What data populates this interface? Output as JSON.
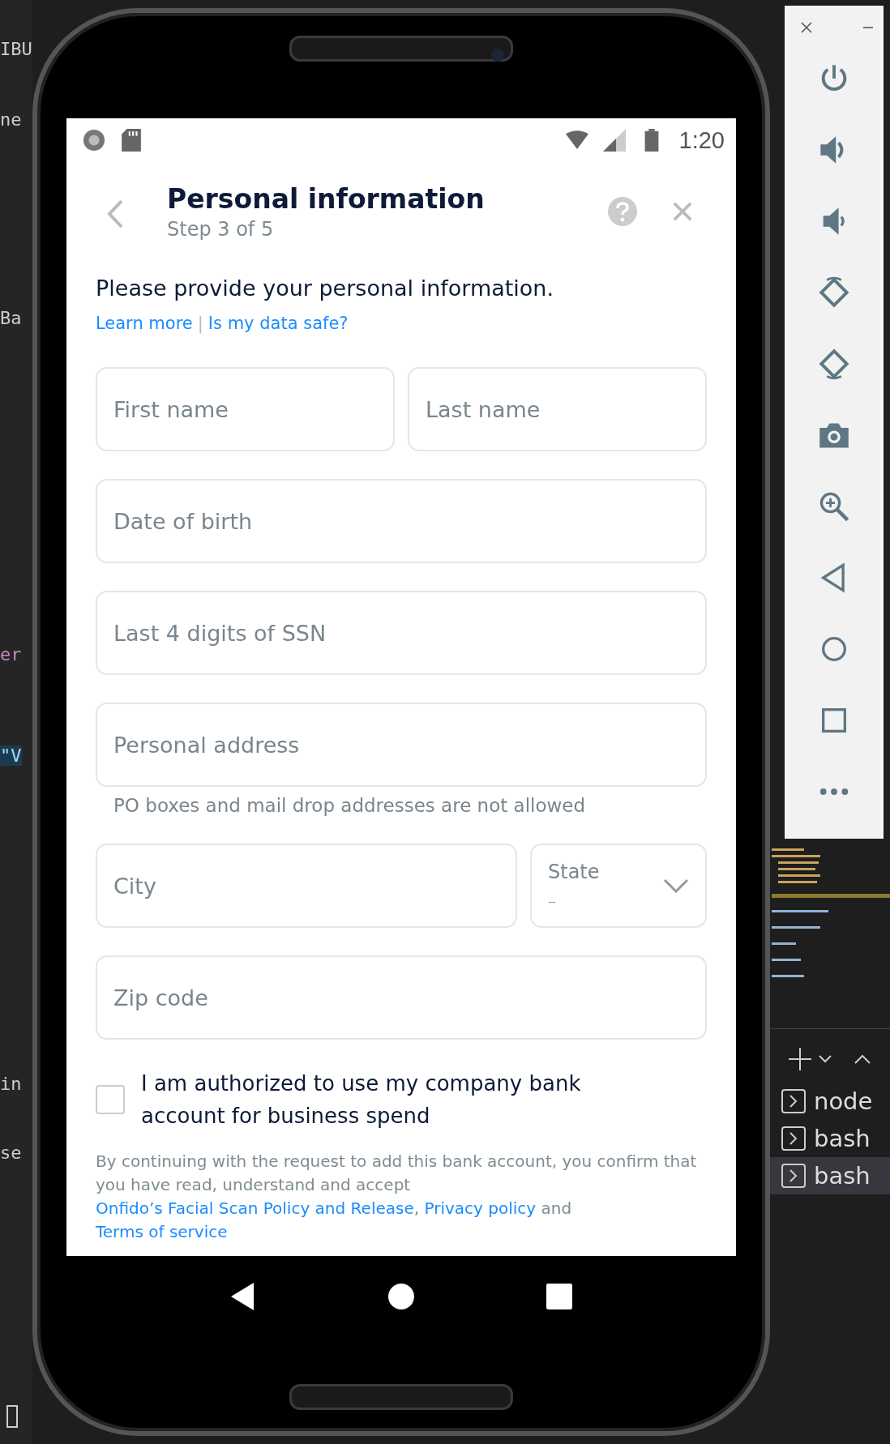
{
  "ide_fragments": [
    {
      "text": "IBU"
    },
    {
      "text": "ne"
    },
    {
      "text": "Ba"
    },
    {
      "text": "er"
    },
    {
      "text": "\"V"
    },
    {
      "text": "in"
    },
    {
      "text": "se"
    }
  ],
  "status_bar": {
    "time": "1:20"
  },
  "header": {
    "title": "Personal information",
    "subtitle": "Step 3 of 5"
  },
  "intro": {
    "text": "Please provide your personal information.",
    "links": [
      "Learn more",
      "Is my data safe?"
    ],
    "separator": "|"
  },
  "field_rows": [
    [
      {
        "kind": "text",
        "placeholder": "First name"
      },
      {
        "kind": "text",
        "placeholder": "Last name"
      }
    ],
    [
      {
        "kind": "text",
        "placeholder": "Date of birth"
      }
    ],
    [
      {
        "kind": "text",
        "placeholder": "Last 4 digits of SSN"
      }
    ],
    [
      {
        "kind": "text",
        "placeholder": "Personal address",
        "hint": "PO boxes and mail drop addresses are not allowed"
      }
    ],
    [
      {
        "kind": "text",
        "placeholder": "City"
      },
      {
        "kind": "select",
        "label": "State",
        "value": "–"
      }
    ],
    [
      {
        "kind": "text",
        "placeholder": "Zip code"
      }
    ]
  ],
  "consent": {
    "checked": false,
    "label": "I am authorized to use my company bank account for business spend"
  },
  "legal": [
    {
      "kind": "text",
      "text": "By continuing with the request to add this bank account, you confirm that you have read, understand and accept "
    },
    {
      "kind": "link",
      "text": "Onfido’s Facial Scan Policy and Release"
    },
    {
      "kind": "text",
      "text": ", "
    },
    {
      "kind": "link",
      "text": "Privacy policy"
    },
    {
      "kind": "text",
      "text": " and "
    },
    {
      "kind": "link",
      "text": "Terms of service"
    }
  ],
  "terminals": [
    {
      "label": "node",
      "selected": false
    },
    {
      "label": "bash",
      "selected": false
    },
    {
      "label": "bash",
      "selected": true
    }
  ]
}
